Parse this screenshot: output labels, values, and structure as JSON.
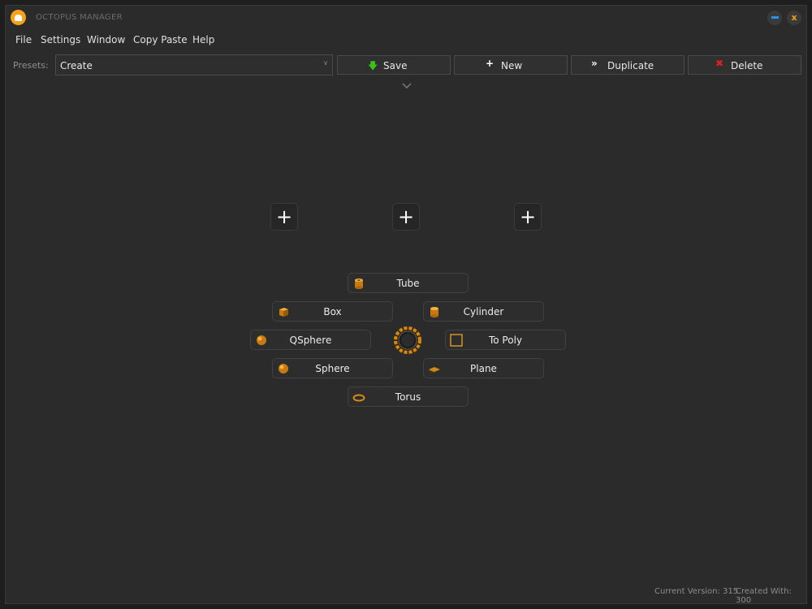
{
  "window": {
    "title": "OCTOPUS MANAGER"
  },
  "menu": [
    "File",
    "Settings",
    "Window",
    "Copy Paste",
    "Help"
  ],
  "toolbar": {
    "presets_label": "Presets:",
    "preset_value": "Create",
    "save_label": "Save",
    "new_label": "New",
    "duplicate_label": "Duplicate",
    "delete_label": "Delete"
  },
  "slots": {
    "left_plus": "+",
    "center_plus": "+",
    "right_plus": "+"
  },
  "objects": {
    "tube": "Tube",
    "box": "Box",
    "cylinder": "Cylinder",
    "qsphere": "QSphere",
    "to_poly": "To Poly",
    "sphere": "Sphere",
    "plane": "Plane",
    "torus": "Torus"
  },
  "status": {
    "current_version": "Current Version: 315",
    "created_with": "Created With: 300"
  },
  "colors": {
    "accent": "#f6a21a",
    "save_icon": "#39c21a",
    "delete_icon": "#e02020",
    "minimize": "#2e8fe8"
  },
  "icons": {
    "save": "arrow-down-icon",
    "new": "plus-icon",
    "duplicate": "double-chevron-right-icon",
    "delete": "x-icon"
  }
}
